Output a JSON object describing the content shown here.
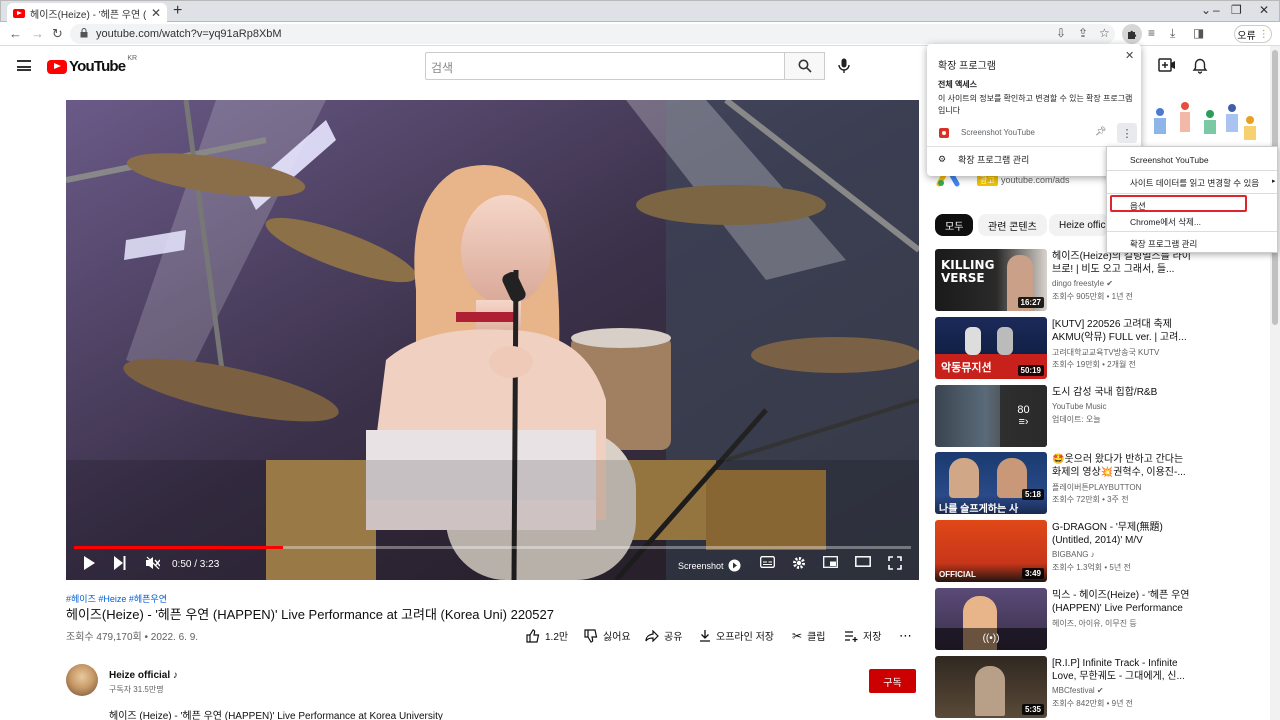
{
  "browser": {
    "tab_title": "헤이즈(Heize) - '헤픈 우연 (HA",
    "url": "youtube.com/watch?v=yq91aRp8XbM",
    "profile_label": "오류"
  },
  "youtube": {
    "logo_text": "YouTube",
    "logo_region": "KR",
    "search_placeholder": "검색"
  },
  "player": {
    "time": "0:50 / 3:23",
    "screenshot_label": "Screenshot",
    "progress_fraction": 0.25
  },
  "video": {
    "hashtags": "#헤이즈 #Heize #헤픈우연",
    "title": "헤이즈(Heize) - '헤픈 우연 (HAPPEN)' Live Performance at 고려대 (Korea Uni) 220527",
    "views_date": "조회수 479,170회 • 2022. 6. 9.",
    "actions": {
      "like": "1.2만",
      "dislike": "싫어요",
      "share": "공유",
      "offline": "오프라인 저장",
      "clip": "클립",
      "save": "저장"
    },
    "channel": "Heize official ♪",
    "subscribers": "구독자 31.5만명",
    "subscribe_label": "구독",
    "description": "헤이즈 (Heize) - '헤픈 우연 (HAPPEN)' Live Performance at Korea University"
  },
  "ad": {
    "badge": "광고",
    "url": "youtube.com/ads"
  },
  "chips": [
    "모두",
    "관련 콘텐츠",
    "Heize offici"
  ],
  "recommendations": [
    {
      "title": "헤이즈(Heize)의 킬링벌스를 라이브로! | 비도 오고 그래서, 들...",
      "channel": "dingo freestyle ✔",
      "meta": "조회수 905만회 • 1년 전",
      "duration": "16:27"
    },
    {
      "title": "[KUTV] 220526 고려대 축제 AKMU(악뮤) FULL ver. | 고려...",
      "channel": "고려대학교교육TV방송국 KUTV",
      "meta": "조회수 19만회 • 2개월 전",
      "duration": "50:19"
    },
    {
      "title": "도시 감성 국내 힙합/R&B",
      "channel": "YouTube Music",
      "meta": "업데이트: 오늘",
      "duration": ""
    },
    {
      "title": "🤩웃으러 왔다가 반하고 간다는 화제의 영상💥권혁수, 이용진-...",
      "channel": "플레이버튼PLAYBUTTON",
      "meta": "조회수 72만회 • 3주 전",
      "duration": "5:18"
    },
    {
      "title": "G-DRAGON - '무제(無題) (Untitled, 2014)' M/V",
      "channel": "BIGBANG ♪",
      "meta": "조회수 1.3억회 • 5년 전",
      "duration": "3:49"
    },
    {
      "title": "믹스 - 헤이즈(Heize) - '헤픈 우연 (HAPPEN)' Live Performance ...",
      "channel": "헤이즈, 아이유, 이무진 등",
      "meta": "",
      "duration": ""
    },
    {
      "title": "[R.I.P] Infinite Track - Infinite Love, 무한궤도 - 그대에게, 신...",
      "channel": "MBCfestival ✔",
      "meta": "조회수 842만회 • 9년 전",
      "duration": "5:35"
    }
  ],
  "playlist_count": "80",
  "thumb_texts": {
    "killing": "KILLING",
    "verse": "VERSE",
    "akmu_caption": "악동뮤지션",
    "show_caption": "나를 슬프게하는 사",
    "official": "OFFICIAL"
  },
  "extensions_popup": {
    "title": "확장 프로그램",
    "access_heading": "전체 액세스",
    "access_desc": "이 사이트의 정보를 확인하고 변경할 수 있는 확장 프로그램입니다",
    "extension_name": "Screenshot YouTube",
    "manage_label": "확장 프로그램 관리"
  },
  "context_menu": {
    "items": [
      "Screenshot YouTube",
      "사이트 데이터를 읽고 변경할 수 있음",
      "옵션",
      "Chrome에서 삭제...",
      "확장 프로그램 관리"
    ]
  }
}
